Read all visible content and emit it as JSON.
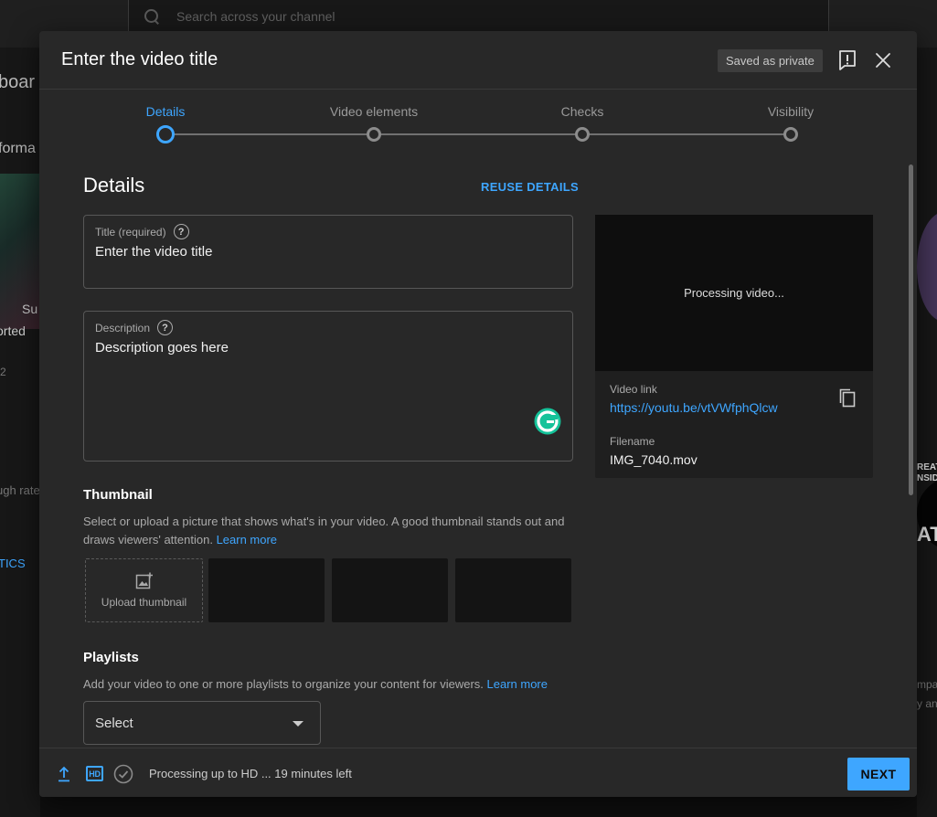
{
  "background": {
    "search_placeholder": "Search across your channel",
    "left_fragments": [
      "boar",
      "forma",
      "S",
      "Su",
      "orted",
      "2",
      "ugh rate",
      "TICS"
    ],
    "right_fragments": [
      "REAT",
      "NSIDI",
      "AT",
      "mpa",
      "y an"
    ]
  },
  "modal": {
    "title": "Enter the video title",
    "saved_badge": "Saved as private",
    "feedback_icon": "alert-feedback-icon",
    "close_icon": "close-icon"
  },
  "stepper": {
    "steps": [
      {
        "label": "Details",
        "active": true
      },
      {
        "label": "Video elements",
        "active": false
      },
      {
        "label": "Checks",
        "active": false
      },
      {
        "label": "Visibility",
        "active": false
      }
    ]
  },
  "details": {
    "heading": "Details",
    "reuse_label": "REUSE DETAILS",
    "title_field": {
      "label": "Title (required)",
      "value": "Enter the video title"
    },
    "description_field": {
      "label": "Description",
      "value": "Description goes here"
    },
    "help_glyph": "?"
  },
  "thumbnail": {
    "heading": "Thumbnail",
    "help_text": "Select or upload a picture that shows what's in your video. A good thumbnail stands out and draws viewers' attention.",
    "learn_more": "Learn more",
    "upload_label": "Upload thumbnail"
  },
  "playlists": {
    "heading": "Playlists",
    "help_text": "Add your video to one or more playlists to organize your content for viewers.",
    "learn_more": "Learn more",
    "select_value": "Select"
  },
  "preview": {
    "processing_text": "Processing video...",
    "video_link_label": "Video link",
    "video_link": "https://youtu.be/vtVWfphQlcw",
    "filename_label": "Filename",
    "filename": "IMG_7040.mov"
  },
  "footer": {
    "hd_label": "HD",
    "status": "Processing up to HD ... 19 minutes left",
    "next_label": "NEXT"
  },
  "colors": {
    "accent": "#3ea6ff",
    "modal_bg": "#282828",
    "page_bg": "#0f0f0f"
  }
}
